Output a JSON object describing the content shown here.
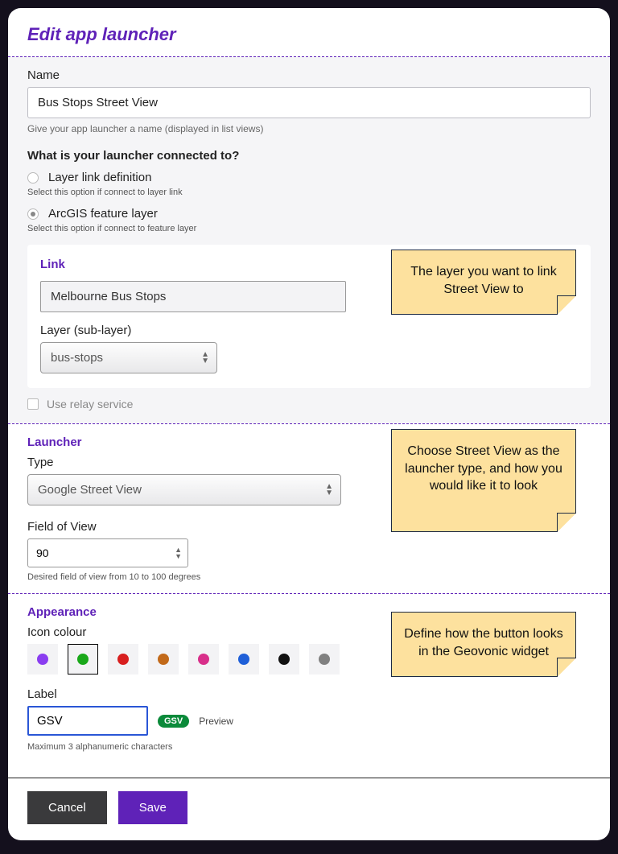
{
  "title": "Edit app launcher",
  "name": {
    "label": "Name",
    "value": "Bus Stops Street View",
    "hint": "Give your app launcher a name (displayed in list views)"
  },
  "connection": {
    "question": "What is your launcher connected to?",
    "option1": {
      "label": "Layer link definition",
      "hint": "Select this option if connect to layer link"
    },
    "option2": {
      "label": "ArcGIS feature layer",
      "hint": "Select this option if connect to feature layer"
    }
  },
  "link": {
    "heading": "Link",
    "value": "Melbourne Bus Stops",
    "sublayer_label": "Layer (sub-layer)",
    "sublayer_value": "bus-stops"
  },
  "relay": {
    "label": "Use relay service"
  },
  "launcher": {
    "heading": "Launcher",
    "type_label": "Type",
    "type_value": "Google Street View",
    "fov_label": "Field of View",
    "fov_value": "90",
    "fov_hint": "Desired field of view from 10 to 100 degrees"
  },
  "appearance": {
    "heading": "Appearance",
    "colour_label": "Icon colour",
    "colours": [
      "#8a3df0",
      "#1aa81a",
      "#d81f1f",
      "#c26a1a",
      "#d82f8a",
      "#1f5fd8",
      "#111111",
      "#808080"
    ],
    "selected_index": 1,
    "label_label": "Label",
    "label_value": "GSV",
    "label_hint": "Maximum 3 alphanumeric characters",
    "preview_chip": "GSV",
    "preview_text": "Preview"
  },
  "notes": {
    "n1": "The layer you want to link Street View to",
    "n2": "Choose Street View as the launcher type, and how you would like it to look",
    "n3": "Define how the button looks in the Geovonic widget"
  },
  "buttons": {
    "cancel": "Cancel",
    "save": "Save"
  }
}
